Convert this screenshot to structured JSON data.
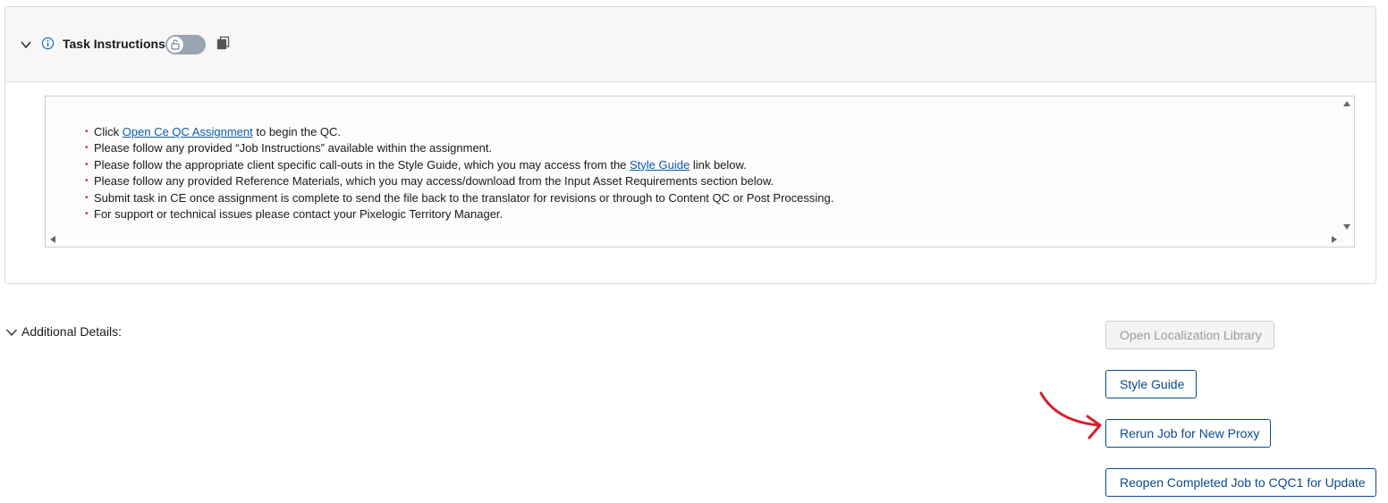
{
  "task_panel": {
    "title": "Task Instructions",
    "instructions": [
      {
        "before": "Click ",
        "link": "Open Ce QC Assignment",
        "after": " to begin the QC."
      },
      {
        "before": "Please follow any provided “Job Instructions” available within the assignment.",
        "link": "",
        "after": ""
      },
      {
        "before": "Please follow the appropriate client specific call-outs in the Style Guide, which you may access from the ",
        "link": "Style Guide",
        "after": " link below."
      },
      {
        "before": "Please follow any provided Reference Materials, which you may access/download from the Input Asset Requirements section below.",
        "link": "",
        "after": ""
      },
      {
        "before": "Submit task in CE once assignment is complete to send the file back to the translator for revisions or through to Content QC or Post Processing.",
        "link": "",
        "after": ""
      },
      {
        "before": "For support or technical issues please contact your Pixelogic Territory Manager.",
        "link": "",
        "after": ""
      }
    ]
  },
  "additional_details": {
    "label": "Additional Details:"
  },
  "buttons": {
    "open_library": "Open Localization Library",
    "style_guide": "Style Guide",
    "rerun_job": "Rerun Job for New Proxy",
    "reopen_job": "Reopen Completed Job to CQC1 for Update"
  },
  "colors": {
    "link": "#0a5ca8",
    "button_border": "#0a4a8a",
    "annotation_arrow": "#d2222d",
    "toggle_off": "#9aa4b2"
  },
  "icons": {
    "header_collapse": "chevron-down-icon",
    "info": "info-icon",
    "lock": "unlock-icon",
    "copy": "copy-icon"
  }
}
